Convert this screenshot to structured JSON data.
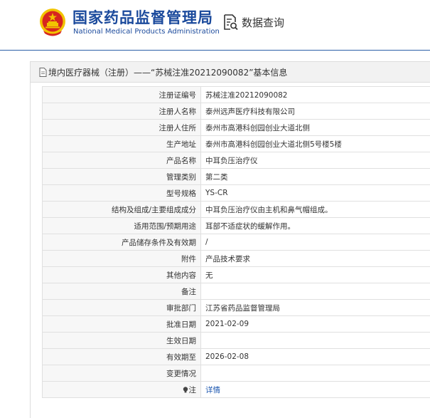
{
  "header": {
    "brand_cn": "国家药品监督管理局",
    "brand_en": "National Medical Products Administration",
    "query_label": "数据查询"
  },
  "panel": {
    "title": "境内医疗器械（注册）——“苏械注准20212090082”基本信息"
  },
  "rows": [
    {
      "label": "注册证编号",
      "value": "苏械注准20212090082"
    },
    {
      "label": "注册人名称",
      "value": "泰州远声医疗科技有限公司"
    },
    {
      "label": "注册人住所",
      "value": "泰州市高港科创园创业大道北侧"
    },
    {
      "label": "生产地址",
      "value": "泰州市高港科创园创业大道北侧5号楼5楼"
    },
    {
      "label": "产品名称",
      "value": "中耳负压治疗仪"
    },
    {
      "label": "管理类别",
      "value": "第二类"
    },
    {
      "label": "型号规格",
      "value": "YS-CR"
    },
    {
      "label": "结构及组成/主要组成成分",
      "value": "中耳负压治疗仪由主机和鼻气帽组成。"
    },
    {
      "label": "适用范围/预期用途",
      "value": "耳部不适症状的缓解作用。"
    },
    {
      "label": "产品储存条件及有效期",
      "value": "/"
    },
    {
      "label": "附件",
      "value": "产品技术要求"
    },
    {
      "label": "其他内容",
      "value": "无"
    },
    {
      "label": "备注",
      "value": ""
    },
    {
      "label": "审批部门",
      "value": "江苏省药品监督管理局"
    },
    {
      "label": "批准日期",
      "value": "2021-02-09"
    },
    {
      "label": "生效日期",
      "value": ""
    },
    {
      "label": "有效期至",
      "value": "2026-02-08"
    },
    {
      "label": "变更情况",
      "value": ""
    },
    {
      "label": "注",
      "value": "详情"
    }
  ],
  "colors": {
    "brand_blue": "#1b4a9c",
    "link_blue": "#1e58b0",
    "emblem_red": "#d7261f",
    "emblem_gold": "#f2c400"
  }
}
